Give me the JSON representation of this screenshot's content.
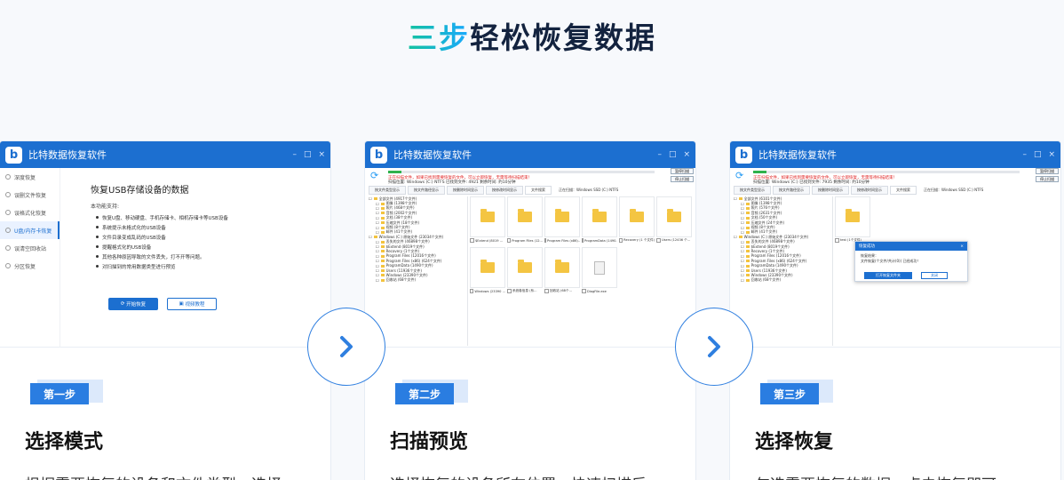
{
  "heading": {
    "part1": "三步",
    "part2": "轻松恢复数据"
  },
  "app_name": "比特数据恢复软件",
  "window_controls": [
    "–",
    "□",
    "×"
  ],
  "steps": [
    {
      "badge": "第一步",
      "title": "选择模式",
      "desc": "根据需要恢复的设备和文件类型，选择"
    },
    {
      "badge": "第二步",
      "title": "扫描预览",
      "desc": "选择恢复的设备所在位置，快速扫描后"
    },
    {
      "badge": "第三步",
      "title": "选择恢复",
      "desc": "勾选需要恢复的数据，点击恢复即可"
    }
  ],
  "step1": {
    "sidebar": [
      "深度恢复",
      "误删文件恢复",
      "误格式化恢复",
      "U盘/内存卡恢复",
      "误清空回收站",
      "分区恢复"
    ],
    "main_title": "恢复USB存储设备的数据",
    "support_label": "本功能支持:",
    "features": [
      "恢复U盘、移动硬盘、手机存储卡、相机存储卡等USB设备",
      "系统提示未格式化的USB设备",
      "文件目录变成乱码的USB设备",
      "提醒格式化的USB设备",
      "其他各种原因导致的文件丢失，打不开等问题。",
      "对扫描到的常用数据类型进行预览"
    ],
    "start_button": "开始恢复",
    "video_button": "视频教程"
  },
  "step2": {
    "progress": 0.05,
    "notice": "正在扫描文件，如果已找到需要恢复的文件，可以立即恢复，无需等待扫描结束！",
    "stats": "扫描位置: Windows (C:) NTFS    已找到文件: 4921    剩余时间: 约10分钟",
    "pause_button": "暂停扫描",
    "stop_button": "停止扫描",
    "tabs": [
      "按文件类型显示",
      "按文件路径显示",
      "按删除时间显示",
      "按修改时间显示",
      "文件搜索",
      "正在扫描：Windows SSD (C:) NTFS"
    ],
    "tree": [
      "全部文件 (4917个文件)",
      "图像 (1398个文件)",
      "照片 (468个文件)",
      "音频 (2002个文件)",
      "文档 (38个文件)",
      "压缩文件 (18个文件)",
      "视频 (8个文件)",
      "邮件 (41个文件)",
      "Windows (C:) 原始文件 (23034个文件)",
      "丢失的文件 (46898个文件)",
      "$Extend (8019个文件)",
      "Recovery (1个文件)",
      "Program Files (12016个文件)",
      "Program Files (x86) (624个文件)",
      "ProgramData (1490个文件)",
      "Users (11936个文件)",
      "Windows (23390个文件)",
      "回收站 (68个文件)"
    ],
    "tiles": [
      {
        "label": "$Extend (8019 ...",
        "type": "folder"
      },
      {
        "label": "Program Files (12...",
        "type": "folder"
      },
      {
        "label": "Program Files (x86)...",
        "type": "folder"
      },
      {
        "label": "ProgramData (1490...",
        "type": "folder"
      },
      {
        "label": "Recovery (1 个文件)",
        "type": "folder"
      },
      {
        "label": "Users (12436 个...",
        "type": "folder"
      },
      {
        "label": "Windows (23390 ...",
        "type": "folder"
      },
      {
        "label": "系统卷信息 (系...",
        "type": "folder"
      },
      {
        "label": "回收站 (68个...",
        "type": "folder"
      },
      {
        "label": "DiagFile.exe",
        "type": "file"
      }
    ]
  },
  "step3": {
    "progress": 0.05,
    "notice": "正在扫描文件，如果已找到需要恢复的文件，可以立即恢复，无需等待扫描结束！",
    "stats": "扫描位置: Windows (C:)    已找到文件: 7935    剩余时间: 约10分钟",
    "pause_button": "暂停扫描",
    "stop_button": "停止扫描",
    "tabs": [
      "按文件类型显示",
      "按文件路径显示",
      "按删除时间显示",
      "按修改时间显示",
      "文件搜索",
      "正在扫描：Windows SSD (C:) NTFS"
    ],
    "tree": [
      "全部文件 (6101个文件)",
      "图像 (1398个文件)",
      "照片 (576个文件)",
      "音频 (2631个文件)",
      "文档 (50个文件)",
      "压缩文件 (24个文件)",
      "视频 (8个文件)",
      "邮件 (41个文件)",
      "Windows (C:) 原始文件 (23034个文件)",
      "丢失的文件 (46898个文件)",
      "$Extend (8019个文件)",
      "Recovery (1个文件)",
      "Program Files (12016个文件)",
      "Program Files (x86) (624个文件)",
      "ProgramData (1490个文件)",
      "Users (11936个文件)",
      "Windows (23390个文件)",
      "回收站 (68个文件)"
    ],
    "tile_label": "test (1个文件)",
    "dialog_title": "恢复成功",
    "dialog_line1": "恢复结果：",
    "dialog_line2": "文件恢复(个文件/共计(0)) 已经成功！",
    "dialog_open": "打开恢复文件夹",
    "dialog_close": "关闭"
  }
}
